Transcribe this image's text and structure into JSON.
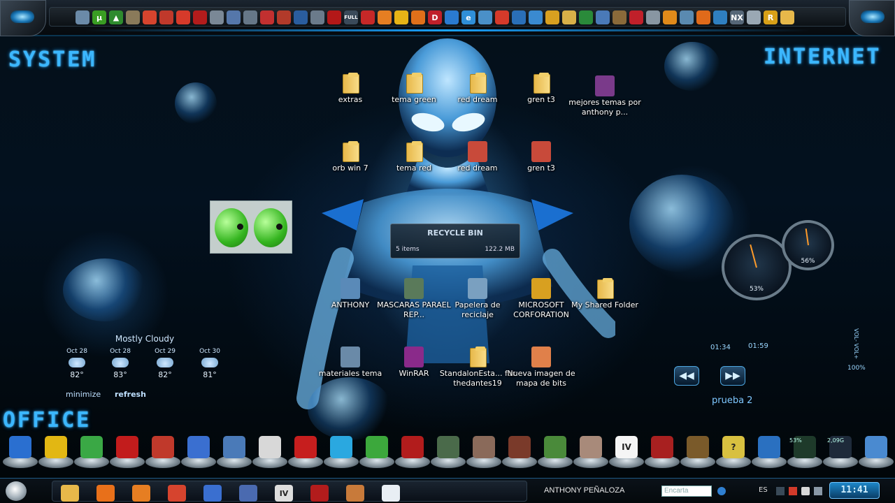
{
  "section_titles": {
    "system": "SYSTEM",
    "internet": "INTERNET",
    "office": "OFFICE"
  },
  "desktop_icons": [
    {
      "label": "extras",
      "kind": "folder"
    },
    {
      "label": "tema green",
      "kind": "folder"
    },
    {
      "label": "red dream",
      "kind": "folder"
    },
    {
      "label": "gren t3",
      "kind": "folder"
    },
    {
      "label": "mejores temas por anthony p...",
      "kind": "winrar-archive"
    },
    {
      "label": "orb win 7",
      "kind": "folder"
    },
    {
      "label": "tema red",
      "kind": "folder"
    },
    {
      "label": "red dream",
      "kind": "image"
    },
    {
      "label": "gren t3",
      "kind": "image"
    },
    {
      "label": "ANTHONY",
      "kind": "user-folder"
    },
    {
      "label": "MASCARAS PARAEL REP...",
      "kind": "image-file"
    },
    {
      "label": "Papelera de reciclaje",
      "kind": "recycle-bin"
    },
    {
      "label": "MICROSOFT CORFORATION",
      "kind": "shortcut"
    },
    {
      "label": "My Shared Folder",
      "kind": "folder"
    },
    {
      "label": "materiales tema",
      "kind": "file"
    },
    {
      "label": "WinRAR",
      "kind": "winrar"
    },
    {
      "label": "StandalonEsta... for thedantes19",
      "kind": "folder"
    },
    {
      "label": "Nueva imagen de mapa de bits",
      "kind": "bitmap"
    }
  ],
  "recycle_bin_tooltip": {
    "title": "RECYCLE BIN",
    "items": "5 items",
    "size": "122.2 MB"
  },
  "weather": {
    "condition": "Mostly Cloudy",
    "days": [
      {
        "date": "Oct 28",
        "temp": "82°"
      },
      {
        "date": "Oct 28",
        "temp": "83°"
      },
      {
        "date": "Oct 29",
        "temp": "82°"
      },
      {
        "date": "Oct 30",
        "temp": "81°"
      }
    ],
    "minimize_label": "minimize",
    "refresh_label": "refresh"
  },
  "media_player": {
    "time_elapsed": "01:34",
    "time_total": "01:59",
    "track": "prueba 2",
    "volume": "100%",
    "vol_label": "VOL- VOL+"
  },
  "gauges": [
    {
      "label": "53%",
      "value": 53
    },
    {
      "label": "56%",
      "value": 56
    }
  ],
  "dock_meters": {
    "cpu": "53%",
    "memory": "2,09G"
  },
  "taskbar": {
    "user": "ANTHONY PEÑALOZA",
    "search_placeholder": "Encarta",
    "language": "ES",
    "clock": "11:41"
  },
  "top_icons": [
    {
      "name": "monitor-icon",
      "color": "#6b8aa8"
    },
    {
      "name": "utorrent-icon",
      "color": "#3a9d23",
      "glyph": "µ"
    },
    {
      "name": "arrow-up-icon",
      "color": "#2e8b2e",
      "glyph": "▲"
    },
    {
      "name": "signpost-icon",
      "color": "#8a7a5a"
    },
    {
      "name": "chrome-icon",
      "color": "#d6442e"
    },
    {
      "name": "burn-icon",
      "color": "#c0392b"
    },
    {
      "name": "pdf-red-icon",
      "color": "#d63a2a"
    },
    {
      "name": "flash-icon",
      "color": "#b21c1c"
    },
    {
      "name": "pen-icon",
      "color": "#7a8896"
    },
    {
      "name": "network-icon",
      "color": "#5577aa"
    },
    {
      "name": "tools-icon",
      "color": "#667788"
    },
    {
      "name": "mouse-red-icon",
      "color": "#c23030"
    },
    {
      "name": "bug-icon",
      "color": "#b23a2a"
    },
    {
      "name": "link-icon",
      "color": "#2a5d9e"
    },
    {
      "name": "wrench-icon",
      "color": "#6b7b8b"
    },
    {
      "name": "lips-icon",
      "color": "#b31818"
    },
    {
      "name": "fullscreen-icon",
      "color": "#3a4a5a",
      "glyph": "FULL"
    },
    {
      "name": "red-screen-icon",
      "color": "#c62828"
    },
    {
      "name": "firefox-icon",
      "color": "#e67e22"
    },
    {
      "name": "smiley-icon",
      "color": "#e7b416"
    },
    {
      "name": "orange-ball-icon",
      "color": "#e0701a"
    },
    {
      "name": "letter-d-icon",
      "color": "#c0202a",
      "glyph": "D"
    },
    {
      "name": "flag-icon",
      "color": "#2a7ad0"
    },
    {
      "name": "ie-icon",
      "color": "#2f8fd8",
      "glyph": "e"
    },
    {
      "name": "card-icon",
      "color": "#4a90c8"
    },
    {
      "name": "wifi-icon",
      "color": "#d63a2a"
    },
    {
      "name": "chart-icon",
      "color": "#2a6fb8"
    },
    {
      "name": "people-icon",
      "color": "#3a8ad0"
    },
    {
      "name": "paint-icon",
      "color": "#d8a020"
    },
    {
      "name": "note-icon",
      "color": "#d8b048"
    },
    {
      "name": "excel-icon",
      "color": "#2a8a3a"
    },
    {
      "name": "book-icon",
      "color": "#4a7ab8"
    },
    {
      "name": "briefcase-icon",
      "color": "#8a6a3a"
    },
    {
      "name": "acrobat-icon",
      "color": "#c0202a"
    },
    {
      "name": "pen-tool-icon",
      "color": "#8896a2"
    },
    {
      "name": "ball-icon",
      "color": "#e08a1a"
    },
    {
      "name": "person-icon",
      "color": "#5a8ab0"
    },
    {
      "name": "avast-icon",
      "color": "#e06a1a"
    },
    {
      "name": "globe-icon",
      "color": "#2f7fc0"
    },
    {
      "name": "nexus-icon",
      "color": "#556677",
      "glyph": "NX"
    },
    {
      "name": "gear-icon",
      "color": "#9aa8b4"
    },
    {
      "name": "r-app-icon",
      "color": "#d8a018",
      "glyph": "R"
    },
    {
      "name": "folder-icon",
      "color": "#e7b84a"
    }
  ],
  "dock_icons": [
    {
      "name": "windows-icon",
      "color": "#2a6fd0"
    },
    {
      "name": "ebay-icon",
      "color": "#e2b713"
    },
    {
      "name": "ball-globe-icon",
      "color": "#3aa845"
    },
    {
      "name": "lips-icon",
      "color": "#c21c1c"
    },
    {
      "name": "burn-icon",
      "color": "#c0392b"
    },
    {
      "name": "cube-icon",
      "color": "#3a6fd0"
    },
    {
      "name": "install-icon",
      "color": "#4a7ab8"
    },
    {
      "name": "swoosh-icon",
      "color": "#d8d8d8"
    },
    {
      "name": "game-cover-icon",
      "color": "#c61e1e"
    },
    {
      "name": "star-icon",
      "color": "#2aa8e0"
    },
    {
      "name": "xbox-icon",
      "color": "#3ca83c"
    },
    {
      "name": "flash-icon",
      "color": "#b21c1c"
    },
    {
      "name": "soldier-icon",
      "color": "#4a6a4a"
    },
    {
      "name": "face-icon",
      "color": "#8a6a5a"
    },
    {
      "name": "mercenary-icon",
      "color": "#7a3a2a"
    },
    {
      "name": "green-face-icon",
      "color": "#4a8a3a"
    },
    {
      "name": "grandpa-icon",
      "color": "#a88a7a"
    },
    {
      "name": "gta-iv-icon",
      "color": "#f5f5f5",
      "glyph": "IV"
    },
    {
      "name": "helmet-icon",
      "color": "#a82020"
    },
    {
      "name": "box-icon",
      "color": "#7a5a2a"
    },
    {
      "name": "question-icon",
      "color": "#d8c040",
      "glyph": "?"
    },
    {
      "name": "angry-birds-icon",
      "color": "#2a70c0"
    },
    {
      "name": "cpu-meter-icon",
      "color": "#1e3a2a"
    },
    {
      "name": "memory-meter-icon",
      "color": "#1e2a3a"
    },
    {
      "name": "photo-icon",
      "color": "#4a8ad0"
    }
  ],
  "taskbar_icons": [
    {
      "name": "explorer-icon",
      "color": "#e7b84a"
    },
    {
      "name": "media-player-icon",
      "color": "#e8701a"
    },
    {
      "name": "firefox-icon",
      "color": "#e67e22"
    },
    {
      "name": "chrome-icon",
      "color": "#d6442e"
    },
    {
      "name": "network-icon",
      "color": "#3a6fd0"
    },
    {
      "name": "game-icon",
      "color": "#4a6ab0"
    },
    {
      "name": "gta-iv-icon",
      "color": "#dddddd",
      "glyph": "IV"
    },
    {
      "name": "flash-icon",
      "color": "#b21c1c"
    },
    {
      "name": "archive-icon",
      "color": "#c87a3a"
    },
    {
      "name": "document-icon",
      "color": "#e8eef4"
    }
  ]
}
